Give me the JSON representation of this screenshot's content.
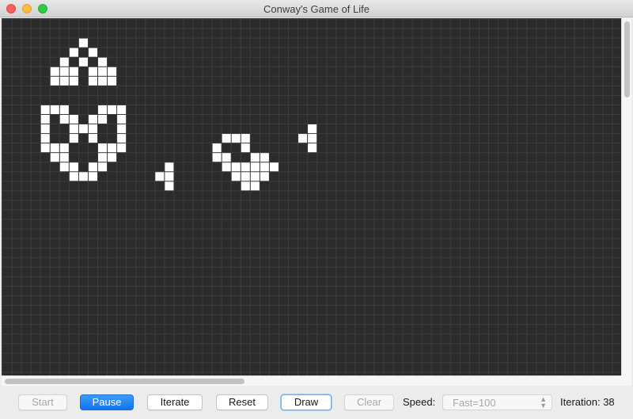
{
  "window": {
    "title": "Conway's Game of Life"
  },
  "colors": {
    "board_bg": "#2b2b2b",
    "grid_line": "#3c3c3c",
    "alive_cell": "#ffffff",
    "accent": "#1173f0"
  },
  "board": {
    "live_cells": [
      [
        8,
        2
      ],
      [
        7,
        3
      ],
      [
        9,
        3
      ],
      [
        6,
        4
      ],
      [
        8,
        4
      ],
      [
        10,
        4
      ],
      [
        6,
        5
      ],
      [
        7,
        5
      ],
      [
        9,
        5
      ],
      [
        10,
        5
      ],
      [
        5,
        5
      ],
      [
        11,
        5
      ],
      [
        6,
        6
      ],
      [
        7,
        6
      ],
      [
        9,
        6
      ],
      [
        10,
        6
      ],
      [
        5,
        6
      ],
      [
        11,
        6
      ],
      [
        4,
        9
      ],
      [
        5,
        9
      ],
      [
        6,
        9
      ],
      [
        10,
        9
      ],
      [
        11,
        9
      ],
      [
        12,
        9
      ],
      [
        4,
        10
      ],
      [
        6,
        10
      ],
      [
        7,
        10
      ],
      [
        9,
        10
      ],
      [
        10,
        10
      ],
      [
        12,
        10
      ],
      [
        4,
        11
      ],
      [
        7,
        11
      ],
      [
        8,
        11
      ],
      [
        9,
        11
      ],
      [
        12,
        11
      ],
      [
        4,
        12
      ],
      [
        7,
        12
      ],
      [
        9,
        12
      ],
      [
        12,
        12
      ],
      [
        4,
        13
      ],
      [
        5,
        13
      ],
      [
        6,
        13
      ],
      [
        10,
        13
      ],
      [
        11,
        13
      ],
      [
        12,
        13
      ],
      [
        5,
        14
      ],
      [
        6,
        14
      ],
      [
        10,
        14
      ],
      [
        11,
        14
      ],
      [
        6,
        15
      ],
      [
        7,
        15
      ],
      [
        9,
        15
      ],
      [
        10,
        15
      ],
      [
        7,
        16
      ],
      [
        8,
        16
      ],
      [
        9,
        16
      ],
      [
        32,
        11
      ],
      [
        31,
        12
      ],
      [
        32,
        12
      ],
      [
        32,
        13
      ],
      [
        23,
        12
      ],
      [
        24,
        12
      ],
      [
        25,
        12
      ],
      [
        22,
        13
      ],
      [
        25,
        13
      ],
      [
        22,
        14
      ],
      [
        23,
        14
      ],
      [
        26,
        14
      ],
      [
        27,
        14
      ],
      [
        23,
        15
      ],
      [
        24,
        15
      ],
      [
        25,
        15
      ],
      [
        26,
        15
      ],
      [
        27,
        15
      ],
      [
        28,
        15
      ],
      [
        24,
        16
      ],
      [
        25,
        16
      ],
      [
        26,
        16
      ],
      [
        27,
        16
      ],
      [
        25,
        17
      ],
      [
        26,
        17
      ],
      [
        17,
        15
      ],
      [
        16,
        16
      ],
      [
        17,
        16
      ],
      [
        17,
        17
      ]
    ]
  },
  "controls": {
    "start_label": "Start",
    "pause_label": "Pause",
    "iterate_label": "Iterate",
    "reset_label": "Reset",
    "draw_label": "Draw",
    "clear_label": "Clear",
    "speed_label": "Speed:",
    "speed_value": "Fast=100",
    "iteration_text": "Iteration: 38"
  }
}
